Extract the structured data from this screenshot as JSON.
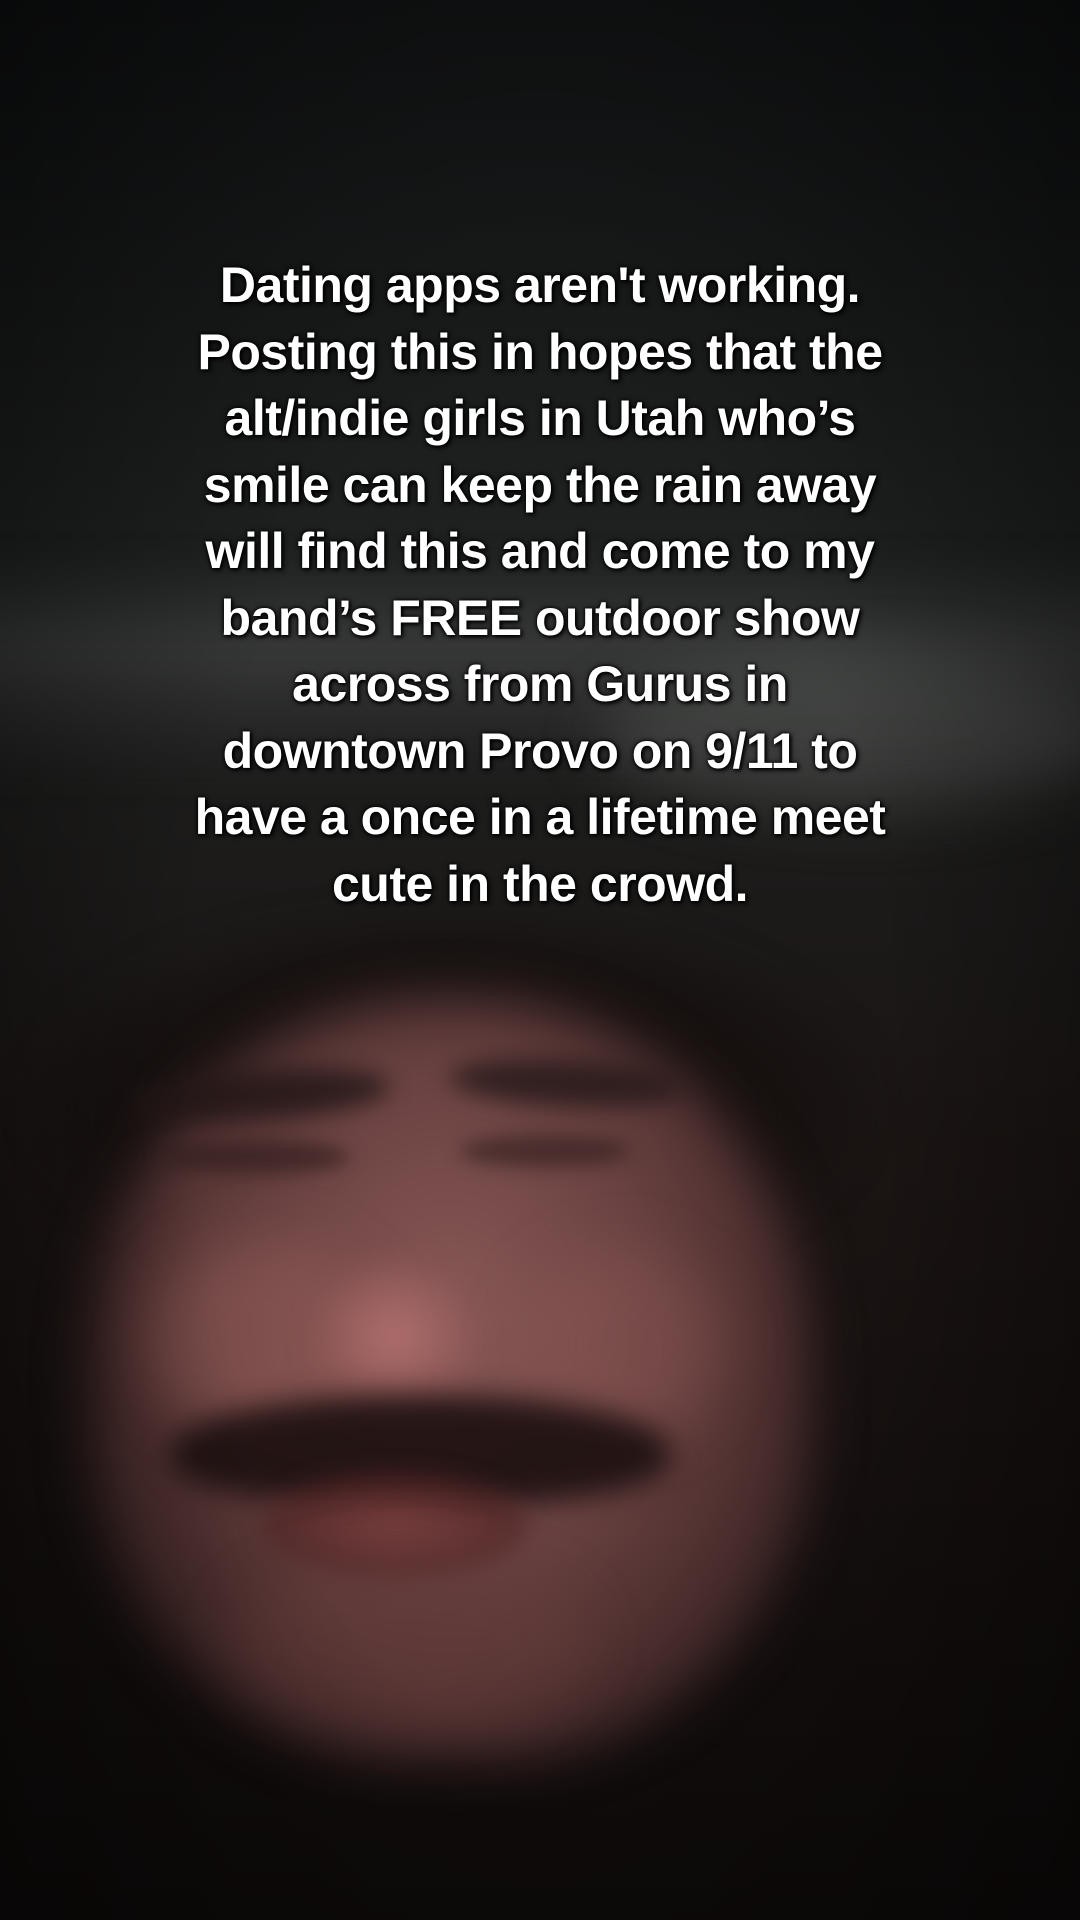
{
  "caption": {
    "lines": [
      "Dating apps aren't working.",
      "Posting this in hopes that the",
      "alt/indie girls in Utah who’s",
      "smile can keep the rain away",
      "will find this and come to my",
      "band’s FREE outdoor show",
      "across from Gurus in",
      "downtown Provo on 9/11 to",
      "have a once in a lifetime meet",
      "cute in the crowd."
    ]
  }
}
